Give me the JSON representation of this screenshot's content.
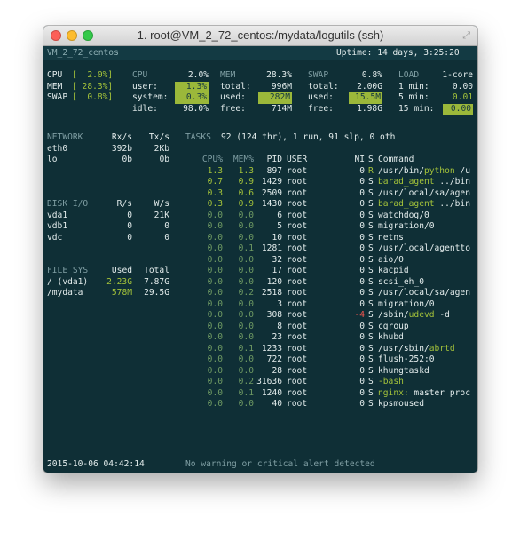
{
  "window": {
    "title": "1. root@VM_2_72_centos:/mydata/logutils (ssh)"
  },
  "header": {
    "hostname": "VM_2_72_centos",
    "uptime": "Uptime: 14 days, 3:25:20"
  },
  "quicklook": {
    "cpu": {
      "label": "CPU",
      "value": "[  2.0%]"
    },
    "mem": {
      "label": "MEM",
      "value": "[ 28.3%]"
    },
    "swap": {
      "label": "SWAP",
      "value": "[  0.8%]"
    }
  },
  "cpu": {
    "title": "CPU",
    "title_value": "2.0%",
    "user_label": "user:",
    "user": "1.3%",
    "system_label": "system:",
    "system": "0.3%",
    "idle_label": "idle:",
    "idle": "98.0%"
  },
  "mem": {
    "title": "MEM",
    "title_value": "28.3%",
    "total_label": "total:",
    "total": "996M",
    "used_label": "used:",
    "used": "282M",
    "free_label": "free:",
    "free": "714M"
  },
  "swap": {
    "title": "SWAP",
    "title_value": "0.8%",
    "total_label": "total:",
    "total": "2.00G",
    "used_label": "used:",
    "used": "15.5M",
    "free_label": "free:",
    "free": "1.98G"
  },
  "load": {
    "title": "LOAD",
    "cores": "1-core",
    "m1_label": "1 min:",
    "m1": "0.00",
    "m5_label": "5 min:",
    "m5": "0.01",
    "m15_label": "15 min:",
    "m15": "0.00"
  },
  "network": {
    "title": "NETWORK",
    "rx": "Rx/s",
    "tx": "Tx/s",
    "rows": [
      {
        "name": "eth0",
        "rx": "392b",
        "tx": "2Kb"
      },
      {
        "name": "lo",
        "rx": "0b",
        "tx": "0b"
      }
    ]
  },
  "disk": {
    "title": "DISK I/O",
    "r": "R/s",
    "w": "W/s",
    "rows": [
      {
        "name": "vda1",
        "r": "0",
        "w": "21K"
      },
      {
        "name": "vdb1",
        "r": "0",
        "w": "0"
      },
      {
        "name": "vdc",
        "r": "0",
        "w": "0"
      }
    ]
  },
  "fs": {
    "title": "FILE SYS",
    "used": "Used",
    "total": "Total",
    "rows": [
      {
        "name": "/ (vda1)",
        "used": "2.23G",
        "total": "7.87G"
      },
      {
        "name": "/mydata",
        "used": "578M",
        "total": "29.5G"
      }
    ]
  },
  "tasks": {
    "label": "TASKS",
    "summary": "92 (124 thr), 1 run, 91 slp, 0 oth"
  },
  "proc_headers": {
    "cpu": "CPU%",
    "mem": "MEM%",
    "pid": "PID",
    "user": "USER",
    "ni": "NI",
    "s": "S",
    "cmd": "Command"
  },
  "processes": [
    {
      "cpu": "1.3",
      "mem": "1.3",
      "pid": "897",
      "user": "root",
      "ni": "0",
      "s": "R",
      "cmd_a": "/usr/bin/",
      "cmd_b": "python",
      "cmd_c": " /u"
    },
    {
      "cpu": "0.7",
      "mem": "0.9",
      "pid": "1429",
      "user": "root",
      "ni": "0",
      "s": "S",
      "cmd_a": "",
      "cmd_b": "barad_agent",
      "cmd_c": " ../bin"
    },
    {
      "cpu": "0.3",
      "mem": "0.6",
      "pid": "2509",
      "user": "root",
      "ni": "0",
      "s": "S",
      "cmd_a": "/usr/local/sa/agen",
      "cmd_b": "",
      "cmd_c": ""
    },
    {
      "cpu": "0.3",
      "mem": "0.9",
      "pid": "1430",
      "user": "root",
      "ni": "0",
      "s": "S",
      "cmd_a": "",
      "cmd_b": "barad_agent",
      "cmd_c": " ../bin"
    },
    {
      "cpu": "0.0",
      "mem": "0.0",
      "pid": "6",
      "user": "root",
      "ni": "0",
      "s": "S",
      "cmd_a": "watchdog/0",
      "cmd_b": "",
      "cmd_c": ""
    },
    {
      "cpu": "0.0",
      "mem": "0.0",
      "pid": "5",
      "user": "root",
      "ni": "0",
      "s": "S",
      "cmd_a": "migration/0",
      "cmd_b": "",
      "cmd_c": ""
    },
    {
      "cpu": "0.0",
      "mem": "0.0",
      "pid": "10",
      "user": "root",
      "ni": "0",
      "s": "S",
      "cmd_a": "netns",
      "cmd_b": "",
      "cmd_c": ""
    },
    {
      "cpu": "0.0",
      "mem": "0.1",
      "pid": "1281",
      "user": "root",
      "ni": "0",
      "s": "S",
      "cmd_a": "/usr/local/agentto",
      "cmd_b": "",
      "cmd_c": ""
    },
    {
      "cpu": "0.0",
      "mem": "0.0",
      "pid": "32",
      "user": "root",
      "ni": "0",
      "s": "S",
      "cmd_a": "aio/0",
      "cmd_b": "",
      "cmd_c": ""
    },
    {
      "cpu": "0.0",
      "mem": "0.0",
      "pid": "17",
      "user": "root",
      "ni": "0",
      "s": "S",
      "cmd_a": "kacpid",
      "cmd_b": "",
      "cmd_c": ""
    },
    {
      "cpu": "0.0",
      "mem": "0.0",
      "pid": "120",
      "user": "root",
      "ni": "0",
      "s": "S",
      "cmd_a": "scsi_eh_0",
      "cmd_b": "",
      "cmd_c": ""
    },
    {
      "cpu": "0.0",
      "mem": "0.2",
      "pid": "2518",
      "user": "root",
      "ni": "0",
      "s": "S",
      "cmd_a": "/usr/local/sa/agen",
      "cmd_b": "",
      "cmd_c": ""
    },
    {
      "cpu": "0.0",
      "mem": "0.0",
      "pid": "3",
      "user": "root",
      "ni": "0",
      "s": "S",
      "cmd_a": "migration/0",
      "cmd_b": "",
      "cmd_c": ""
    },
    {
      "cpu": "0.0",
      "mem": "0.0",
      "pid": "308",
      "user": "root",
      "ni": "-4",
      "s": "S",
      "cmd_a": "/sbin/",
      "cmd_b": "udevd",
      "cmd_c": " -d"
    },
    {
      "cpu": "0.0",
      "mem": "0.0",
      "pid": "8",
      "user": "root",
      "ni": "0",
      "s": "S",
      "cmd_a": "cgroup",
      "cmd_b": "",
      "cmd_c": ""
    },
    {
      "cpu": "0.0",
      "mem": "0.0",
      "pid": "23",
      "user": "root",
      "ni": "0",
      "s": "S",
      "cmd_a": "khubd",
      "cmd_b": "",
      "cmd_c": ""
    },
    {
      "cpu": "0.0",
      "mem": "0.1",
      "pid": "1233",
      "user": "root",
      "ni": "0",
      "s": "S",
      "cmd_a": "/usr/sbin/",
      "cmd_b": "abrtd",
      "cmd_c": ""
    },
    {
      "cpu": "0.0",
      "mem": "0.0",
      "pid": "722",
      "user": "root",
      "ni": "0",
      "s": "S",
      "cmd_a": "flush-252:0",
      "cmd_b": "",
      "cmd_c": ""
    },
    {
      "cpu": "0.0",
      "mem": "0.0",
      "pid": "28",
      "user": "root",
      "ni": "0",
      "s": "S",
      "cmd_a": "khungtaskd",
      "cmd_b": "",
      "cmd_c": ""
    },
    {
      "cpu": "0.0",
      "mem": "0.2",
      "pid": "31636",
      "user": "root",
      "ni": "0",
      "s": "S",
      "cmd_a": "",
      "cmd_b": "-bash",
      "cmd_c": ""
    },
    {
      "cpu": "0.0",
      "mem": "0.1",
      "pid": "1240",
      "user": "root",
      "ni": "0",
      "s": "S",
      "cmd_a": "",
      "cmd_b": "nginx:",
      "cmd_c": " master proc"
    },
    {
      "cpu": "0.0",
      "mem": "0.0",
      "pid": "40",
      "user": "root",
      "ni": "0",
      "s": "S",
      "cmd_a": "kpsmoused",
      "cmd_b": "",
      "cmd_c": ""
    }
  ],
  "footer": {
    "datetime": "2015-10-06 04:42:14",
    "alert": "No warning or critical alert detected"
  }
}
